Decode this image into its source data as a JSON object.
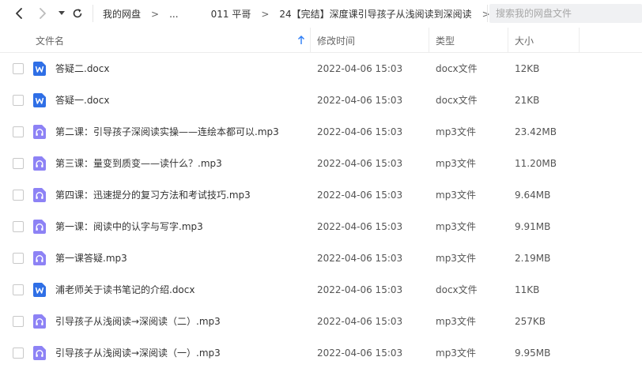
{
  "nav": {
    "back_icon": "chevron-left-icon",
    "forward_icon": "chevron-right-icon",
    "dropdown_icon": "caret-down-icon",
    "refresh_icon": "refresh-icon"
  },
  "breadcrumb": {
    "items": [
      "我的网盘",
      "...",
      "011 平哥",
      "24【完结】深度课引导孩子从浅阅读到深阅读"
    ],
    "separator": ">"
  },
  "search": {
    "placeholder": "搜索我的网盘文件",
    "value": ""
  },
  "table": {
    "headers": {
      "name": "文件名",
      "modified": "修改时间",
      "type": "类型",
      "size": "大小"
    },
    "sort_icon": "arrow-up-icon",
    "sort_color": "#2b7cf6",
    "rows": [
      {
        "icon": "word-doc-icon",
        "name": "答疑二.docx",
        "modified": "2022-04-06 15:03",
        "type": "docx文件",
        "size": "12KB"
      },
      {
        "icon": "word-doc-icon",
        "name": "答疑一.docx",
        "modified": "2022-04-06 15:03",
        "type": "docx文件",
        "size": "21KB"
      },
      {
        "icon": "audio-file-icon",
        "name": "第二课：引导孩子深阅读实操——连绘本都可以.mp3",
        "modified": "2022-04-06 15:03",
        "type": "mp3文件",
        "size": "23.42MB"
      },
      {
        "icon": "audio-file-icon",
        "name": "第三课：量变到质变——读什么？.mp3",
        "modified": "2022-04-06 15:03",
        "type": "mp3文件",
        "size": "11.20MB"
      },
      {
        "icon": "audio-file-icon",
        "name": "第四课：迅速提分的复习方法和考试技巧.mp3",
        "modified": "2022-04-06 15:03",
        "type": "mp3文件",
        "size": "9.64MB"
      },
      {
        "icon": "audio-file-icon",
        "name": "第一课：阅读中的认字与写字.mp3",
        "modified": "2022-04-06 15:03",
        "type": "mp3文件",
        "size": "9.91MB"
      },
      {
        "icon": "audio-file-icon",
        "name": "第一课答疑.mp3",
        "modified": "2022-04-06 15:03",
        "type": "mp3文件",
        "size": "2.19MB"
      },
      {
        "icon": "word-doc-icon",
        "name": "浦老师关于读书笔记的介绍.docx",
        "modified": "2022-04-06 15:03",
        "type": "docx文件",
        "size": "11KB"
      },
      {
        "icon": "audio-file-icon",
        "name": "引导孩子从浅阅读→深阅读（二）.mp3",
        "modified": "2022-04-06 15:03",
        "type": "mp3文件",
        "size": "257KB"
      },
      {
        "icon": "audio-file-icon",
        "name": "引导孩子从浅阅读→深阅读（一）.mp3",
        "modified": "2022-04-06 15:03",
        "type": "mp3文件",
        "size": "9.95MB"
      }
    ]
  },
  "colors": {
    "word_icon": "#2f6fe6",
    "audio_icon": "#8d82f5"
  }
}
